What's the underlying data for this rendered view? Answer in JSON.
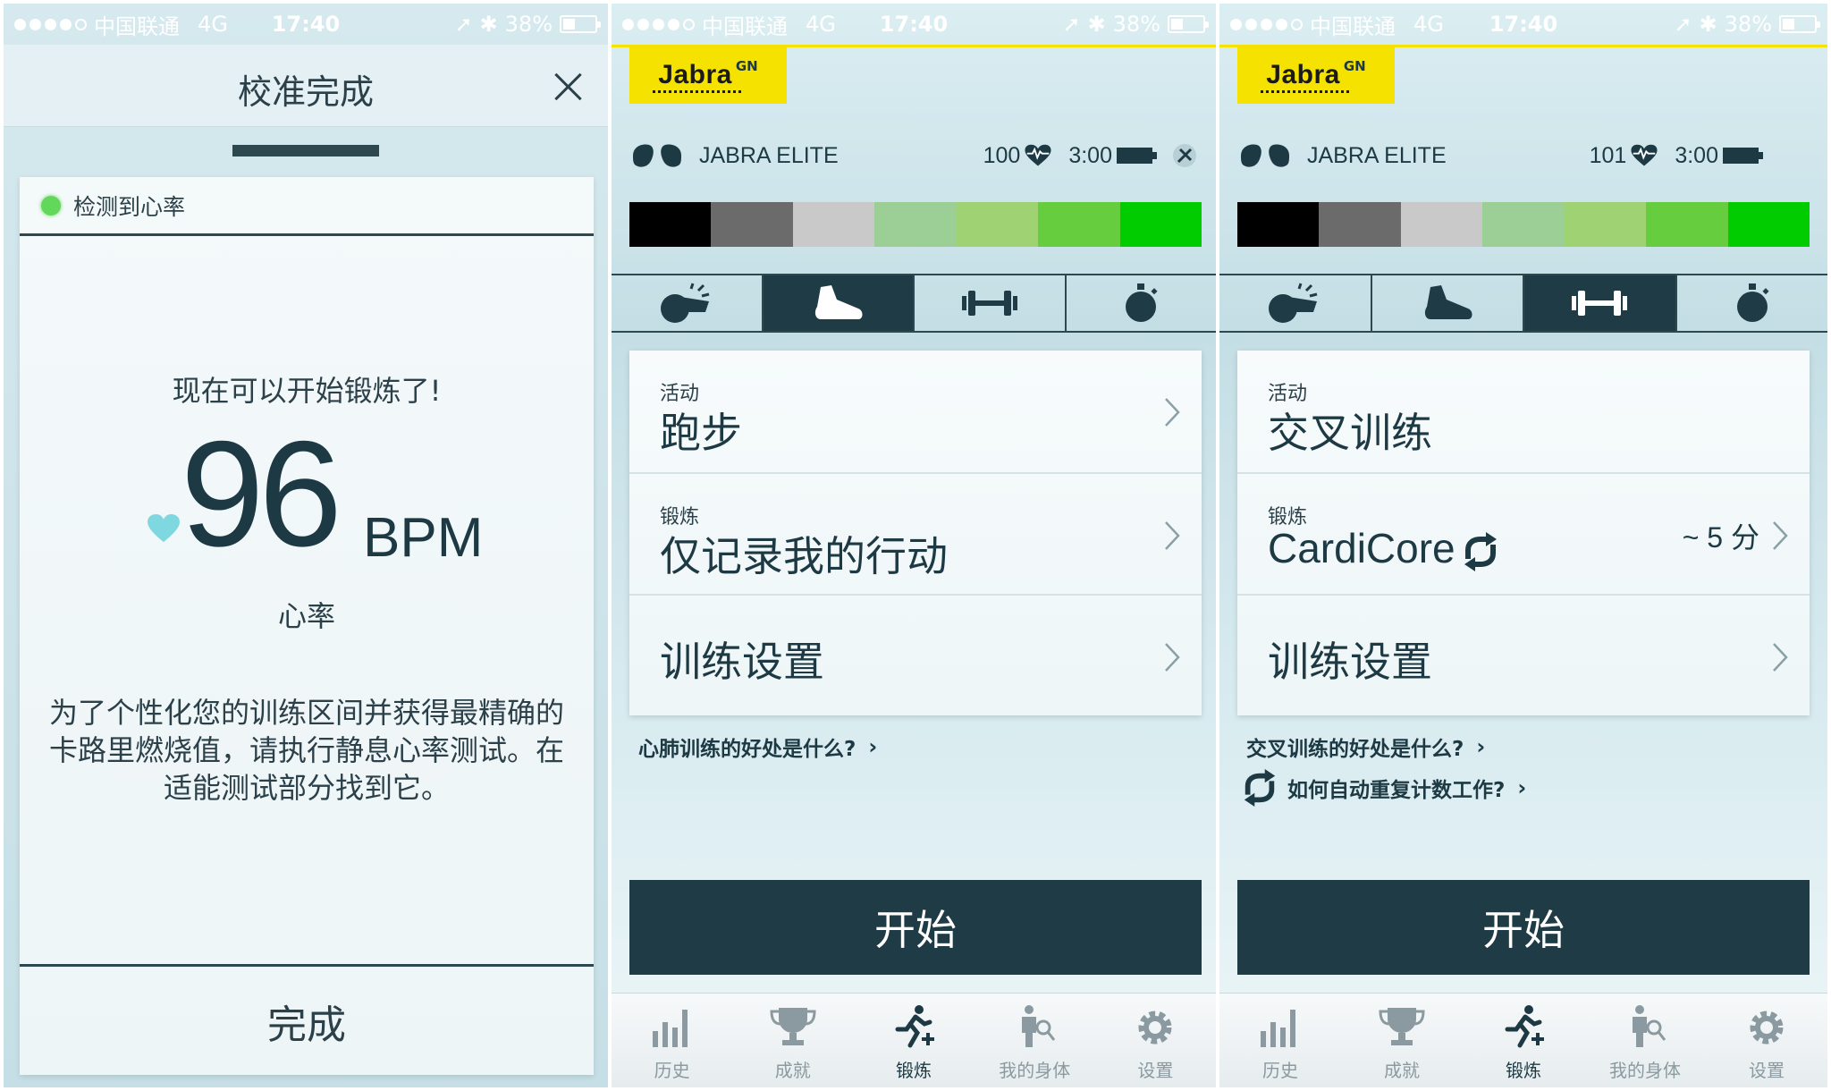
{
  "statusbar": {
    "carrier": "中国联通",
    "network": "4G",
    "time": "17:40",
    "battery": "38%",
    "battery_level": 0.38
  },
  "screen1": {
    "title": "校准完成",
    "progress": 1.0,
    "detect_label": "检测到心率",
    "ready_text": "现在可以开始锻炼了!",
    "heart_rate_value": "96",
    "heart_rate_unit": "BPM",
    "heart_rate_label": "心率",
    "info_text": "为了个性化您的训练区间并获得最精确的卡路里燃烧值，请执行静息心率测试。在适能测试部分找到它。",
    "done_label": "完成"
  },
  "screen2": {
    "device_name": "JABRA ELITE",
    "heart_rate": "100",
    "battery_time": "3:00",
    "active_mode": 1,
    "activity_label": "活动",
    "activity_value": "跑步",
    "workout_label": "锻炼",
    "workout_value": "仅记录我的行动",
    "settings_label": "训练设置",
    "link1": "心肺训练的好处是什么?",
    "start_label": "开始",
    "active_tab": 2
  },
  "screen3": {
    "device_name": "JABRA ELITE",
    "heart_rate": "101",
    "battery_time": "3:00",
    "active_mode": 2,
    "activity_label": "活动",
    "activity_value": "交叉训练",
    "workout_label": "锻炼",
    "workout_value": "CardiCore",
    "workout_duration": "~ 5 分",
    "settings_label": "训练设置",
    "link1": "交叉训练的好处是什么?",
    "link2": "如何自动重复计数工作?",
    "start_label": "开始",
    "active_tab": 2
  },
  "logo": {
    "text": "Jabra",
    "sup": "GN"
  },
  "zone_colors": [
    "#000000",
    "#6b6b6b",
    "#c9c9c9",
    "#9bcf95",
    "#9fd273",
    "#66cd3f",
    "#00cc00"
  ],
  "tabs": [
    "历史",
    "成就",
    "锻炼",
    "我的身体",
    "设置"
  ],
  "colors": {
    "dark": "#1f3b45",
    "accent_yellow": "#f5e200",
    "heart": "#7fd7e0",
    "detect_dot": "#62d85a"
  }
}
